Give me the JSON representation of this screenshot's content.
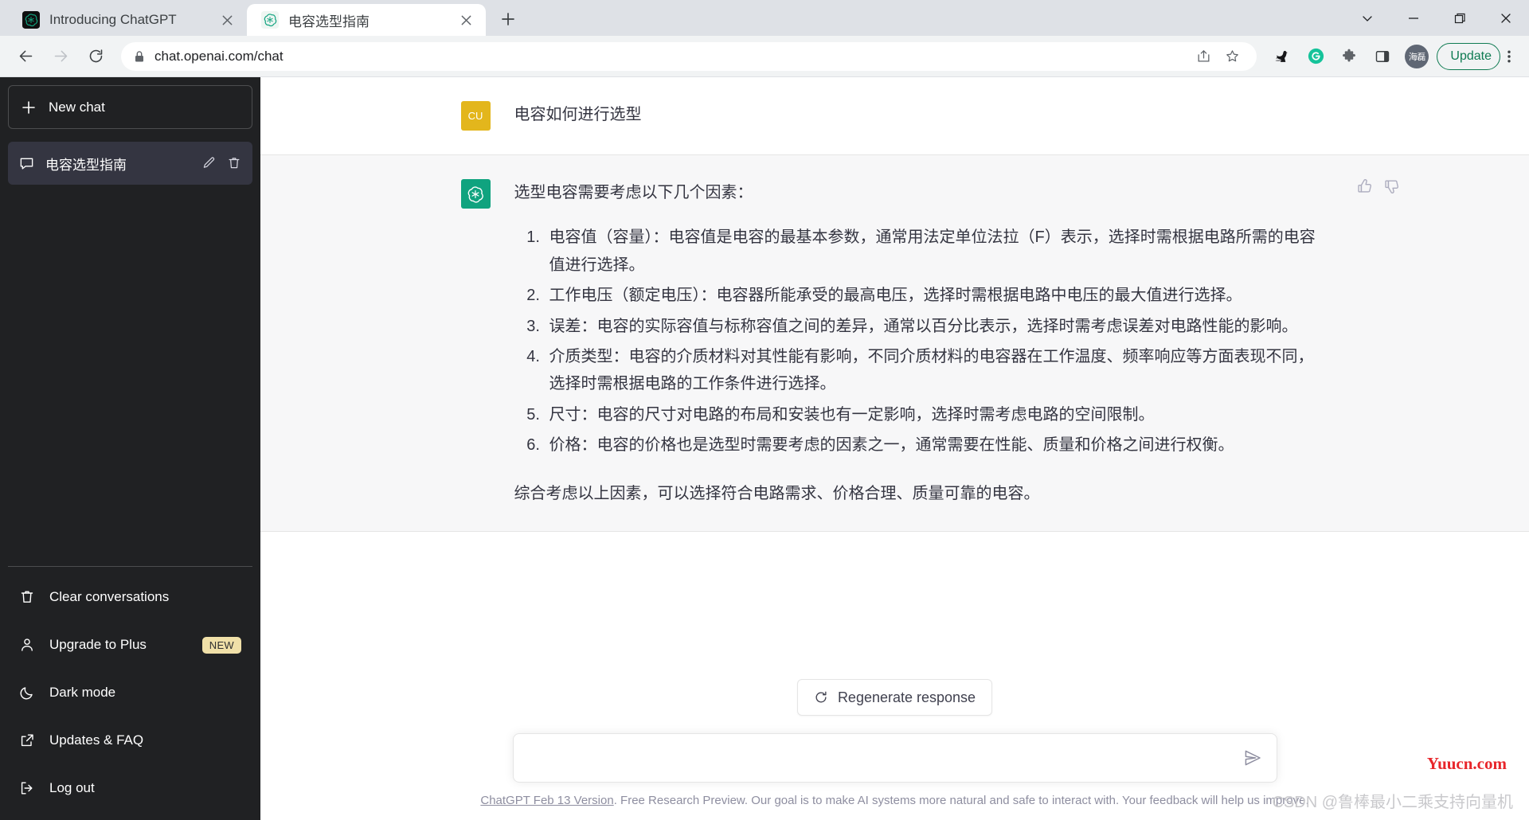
{
  "window": {
    "controls": [
      {
        "name": "tab-search",
        "glyph": "chevron-down"
      },
      {
        "name": "minimize",
        "glyph": "minus"
      },
      {
        "name": "maximize",
        "glyph": "square"
      },
      {
        "name": "close",
        "glyph": "cross"
      }
    ]
  },
  "browser": {
    "tabs": [
      {
        "title": "Introducing ChatGPT",
        "active": false,
        "favicon": "openai-logo-icon"
      },
      {
        "title": "电容选型指南",
        "active": true,
        "favicon": "openai-logo-icon"
      }
    ],
    "new_tab_label": "+",
    "omnibox": {
      "url": "chat.openai.com/chat",
      "lock_icon": "lock-icon",
      "share_icon": "share-icon",
      "bookmark_icon": "star-icon"
    },
    "extensions": [
      {
        "name": "bird-extension-icon"
      },
      {
        "name": "grammarly-icon",
        "label": "G",
        "color": "#15c39a"
      },
      {
        "name": "extensions-puzzle-icon"
      },
      {
        "name": "side-panel-icon"
      }
    ],
    "profile": {
      "initials": "海磊"
    },
    "update_button": {
      "label": "Update",
      "color": "#0f7b52"
    },
    "menu_icon": "three-dot-menu-icon"
  },
  "sidebar": {
    "new_chat": {
      "label": "New chat",
      "icon": "plus-icon"
    },
    "conversations": [
      {
        "title": "电容选型指南",
        "icon": "message-icon",
        "edit_icon": "pencil-icon",
        "delete_icon": "trash-icon",
        "active": true
      }
    ],
    "bottom_items": [
      {
        "label": "Clear conversations",
        "icon": "trash-icon",
        "badge": null
      },
      {
        "label": "Upgrade to Plus",
        "icon": "person-icon",
        "badge": "NEW"
      },
      {
        "label": "Dark mode",
        "icon": "moon-icon",
        "badge": null
      },
      {
        "label": "Updates & FAQ",
        "icon": "external-link-icon",
        "badge": null
      },
      {
        "label": "Log out",
        "icon": "logout-icon",
        "badge": null
      }
    ]
  },
  "conversation": {
    "messages": [
      {
        "role": "user",
        "avatar_initials": "CU",
        "avatar_color": "#e3b61c",
        "text": "电容如何进行选型"
      },
      {
        "role": "assistant",
        "avatar_icon": "openai-logo-icon",
        "avatar_color": "#10a37f",
        "intro": "选型电容需要考虑以下几个因素：",
        "list": [
          "电容值（容量）：电容值是电容的最基本参数，通常用法定单位法拉（F）表示，选择时需根据电路所需的电容值进行选择。",
          "工作电压（额定电压）：电容器所能承受的最高电压，选择时需根据电路中电压的最大值进行选择。",
          "误差：电容的实际容值与标称容值之间的差异，通常以百分比表示，选择时需考虑误差对电路性能的影响。",
          "介质类型：电容的介质材料对其性能有影响，不同介质材料的电容器在工作温度、频率响应等方面表现不同，选择时需根据电路的工作条件进行选择。",
          "尺寸：电容的尺寸对电路的布局和安装也有一定影响，选择时需考虑电路的空间限制。",
          "价格：电容的价格也是选型时需要考虑的因素之一，通常需要在性能、质量和价格之间进行权衡。"
        ],
        "closing": "综合考虑以上因素，可以选择符合电路需求、价格合理、质量可靠的电容。",
        "feedback": {
          "up_icon": "thumbs-up-icon",
          "down_icon": "thumbs-down-icon"
        }
      }
    ]
  },
  "composer": {
    "regenerate_label": "Regenerate response",
    "regenerate_icon": "refresh-icon",
    "input_value": "",
    "input_placeholder": "",
    "send_icon": "send-icon"
  },
  "footer": {
    "link_text": "ChatGPT Feb 13 Version",
    "rest_text": ". Free Research Preview. Our goal is to make AI systems more natural and safe to interact with. Your feedback will help us improve."
  },
  "watermarks": {
    "red": "Yuucn.com",
    "gray": "CSDN @鲁棒最小二乘支持向量机",
    "red_color": "#e8262b",
    "gray_color": "#c9c9cc"
  }
}
